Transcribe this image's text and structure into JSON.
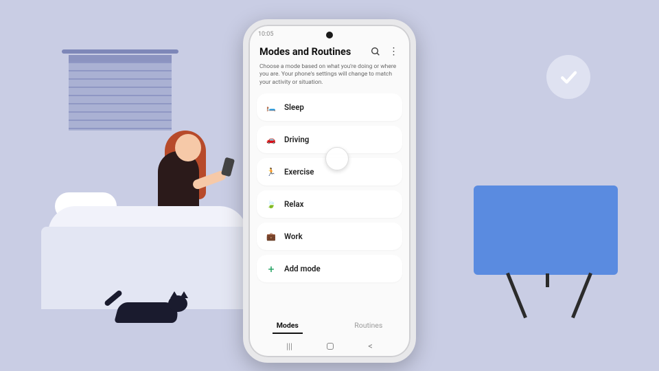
{
  "status": {
    "time": "10:05"
  },
  "header": {
    "title": "Modes and Routines",
    "search_icon": "search",
    "more_icon": "more"
  },
  "description": "Choose a mode based on what you're doing or where you are. Your phone's settings will change to match your activity or situation.",
  "modes": [
    {
      "label": "Sleep",
      "icon": "🛏️"
    },
    {
      "label": "Driving",
      "icon": "🚗"
    },
    {
      "label": "Exercise",
      "icon": "🏃"
    },
    {
      "label": "Relax",
      "icon": "🍃"
    },
    {
      "label": "Work",
      "icon": "💼"
    }
  ],
  "add_mode": {
    "label": "Add mode",
    "icon": "+"
  },
  "tabs": {
    "modes": "Modes",
    "routines": "Routines",
    "active": "modes"
  },
  "nav": {
    "recents": "|||",
    "home": "",
    "back": "<"
  }
}
